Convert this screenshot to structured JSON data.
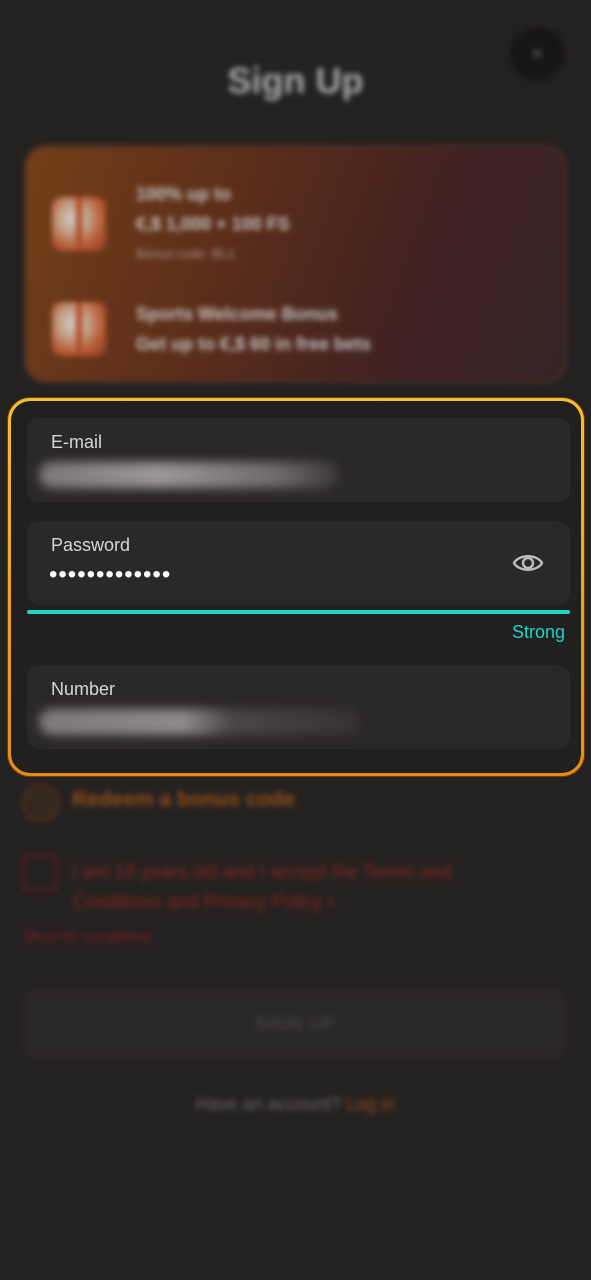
{
  "header": {
    "title": "Sign Up",
    "close_icon": "close-icon",
    "close_glyph": "×"
  },
  "bonuses": [
    {
      "icon": "gift-icon",
      "line1": "100% up to",
      "line2": "€,$ 1,000 + 100 FS",
      "line3": "Bonus code: BL1"
    },
    {
      "icon": "gift-icon",
      "line1": "Sports Welcome Bonus",
      "line2": "Get up to €,$ 60 in free bets"
    }
  ],
  "form": {
    "email_label": "E-mail",
    "password_label": "Password",
    "password_value": "•••••••••••••",
    "password_strength": "Strong",
    "eye_icon": "eye-icon",
    "number_label": "Number"
  },
  "options": {
    "redeem_label": "Redeem a bonus code",
    "terms_text": "I am 18 years old and I accept the Terms and Conditions and Privacy Policy",
    "terms_suffix": " ›",
    "must_be_completed": "Must be completed"
  },
  "footer": {
    "signup_label": "SIGN UP",
    "have_account": "Have an account?",
    "login_label": "Log in"
  },
  "colors": {
    "accent_orange": "#e88a16",
    "strength_teal": "#1fd3c6",
    "error_red": "#9b1f1f"
  }
}
